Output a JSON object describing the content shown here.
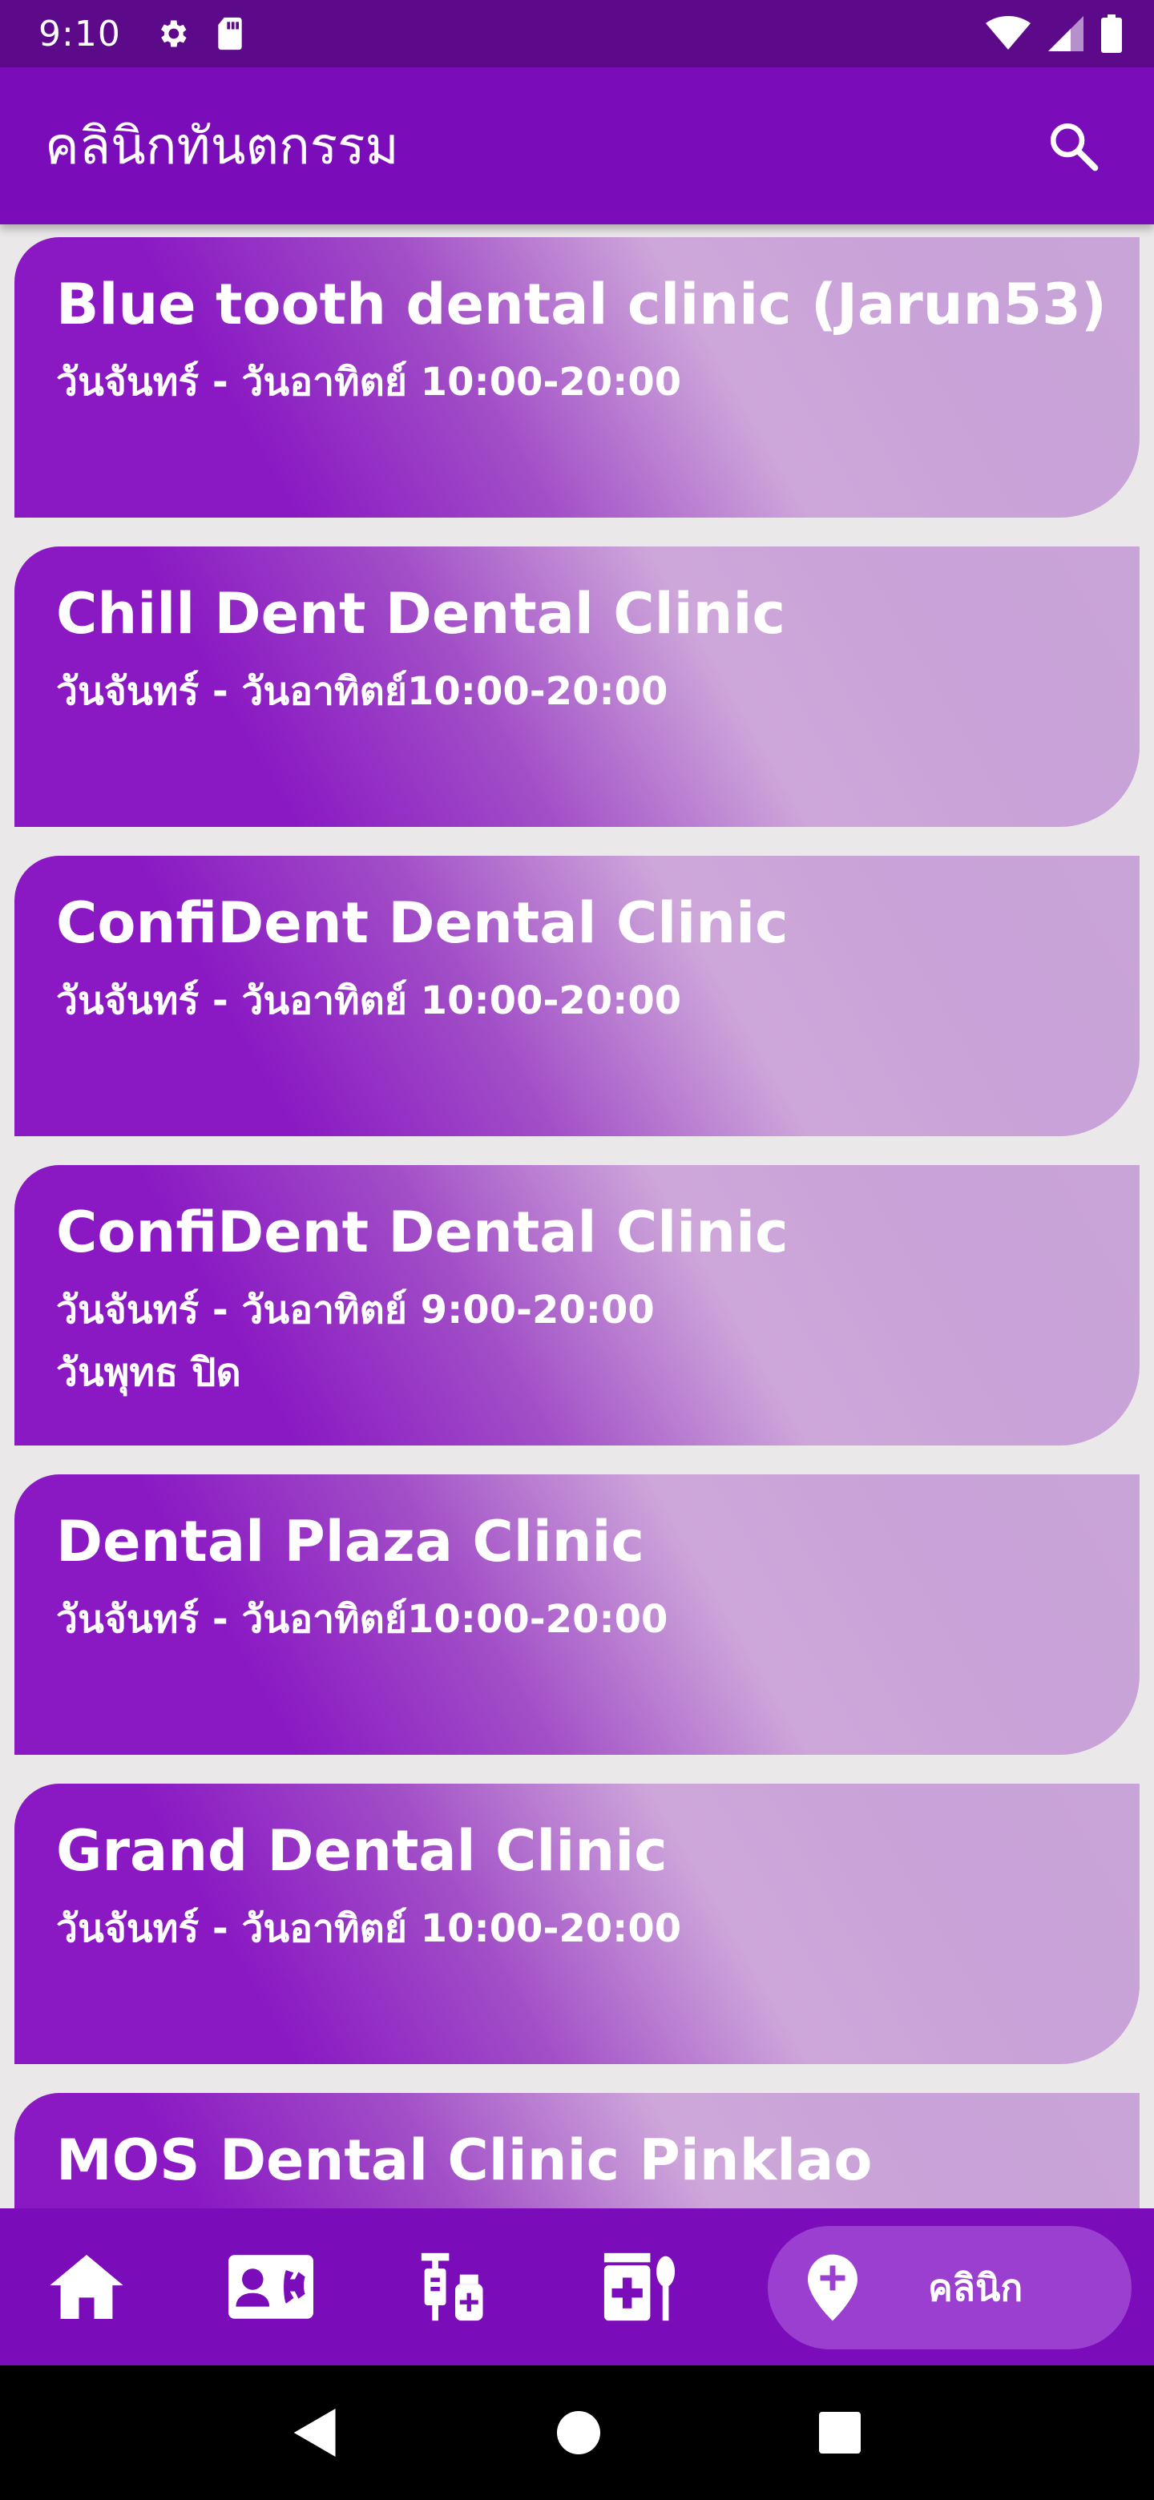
{
  "status_bar": {
    "time": "9:10",
    "icons": [
      "gear-icon",
      "sd-card-icon",
      "wifi-icon",
      "signal-icon",
      "battery-icon"
    ]
  },
  "app_bar": {
    "title": "คลินิกทันตกรรม",
    "search_icon": "search-icon"
  },
  "clinics": [
    {
      "name": "Blue tooth dental clinic (Jarun53)",
      "hours": "วันจันทร์ - วันอาทิตย์  10:00-20:00",
      "note": ""
    },
    {
      "name": "Chill Dent Dental Clinic",
      "hours": "วันจันทร์ - วันอาทิตย์10:00-20:00",
      "note": ""
    },
    {
      "name": "ConfiDent Dental Clinic",
      "hours": "วันจันทร์ - วันอาทิตย์  10:00-20:00",
      "note": ""
    },
    {
      "name": "ConfiDent Dental Clinic",
      "hours": "วันจันทร์ - วันอาทิตย์ 9:00-20:00",
      "note": "วันพุทธ ปิด"
    },
    {
      "name": "Dental Plaza Clinic",
      "hours": "วันจันทร์ - วันอาทิตย์10:00-20:00",
      "note": ""
    },
    {
      "name": "Grand Dental Clinic",
      "hours": "วันจันทร์ - วันอาทิตย์  10:00-20:00",
      "note": ""
    },
    {
      "name": "MOS Dental Clinic Pinklao",
      "hours": "",
      "note": ""
    }
  ],
  "bottom_nav": {
    "items": [
      "home-icon",
      "contact-card-icon",
      "medicine-icon",
      "food-icon"
    ],
    "active": {
      "icon": "location-pin-icon",
      "label": "คลินิก"
    },
    "colors": {
      "bar": "#7b0cba",
      "active_pill": "#9a3fcf"
    }
  },
  "system_nav": [
    "back-icon",
    "home-circle-icon",
    "recents-icon"
  ]
}
